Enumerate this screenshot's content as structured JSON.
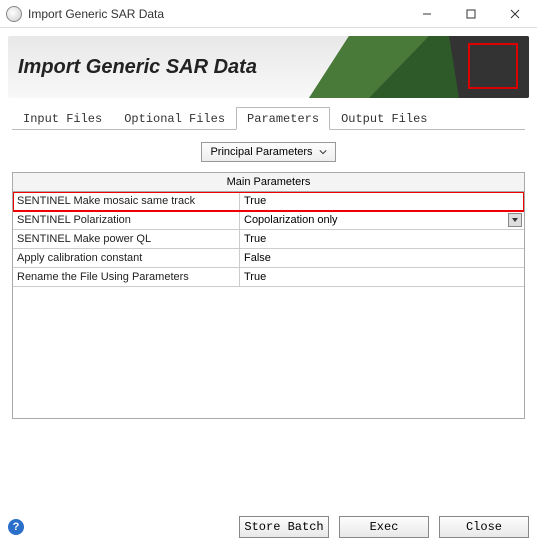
{
  "window": {
    "title": "Import Generic SAR Data"
  },
  "header": {
    "title": "Import Generic SAR Data"
  },
  "tabs": {
    "items": [
      "Input Files",
      "Optional Files",
      "Parameters",
      "Output Files"
    ],
    "active_index": 2
  },
  "dropdown": {
    "label": "Principal Parameters"
  },
  "table": {
    "header": "Main Parameters",
    "rows": [
      {
        "label": "SENTINEL Make mosaic same track",
        "value": "True",
        "highlight": true
      },
      {
        "label": "SENTINEL Polarization",
        "value": "Copolarization only",
        "select": true
      },
      {
        "label": "SENTINEL Make power QL",
        "value": "True"
      },
      {
        "label": "Apply calibration constant",
        "value": "False"
      },
      {
        "label": "Rename the File Using Parameters",
        "value": "True"
      }
    ]
  },
  "footer": {
    "buttons": {
      "store": "Store Batch",
      "exec": "Exec",
      "close": "Close"
    }
  }
}
